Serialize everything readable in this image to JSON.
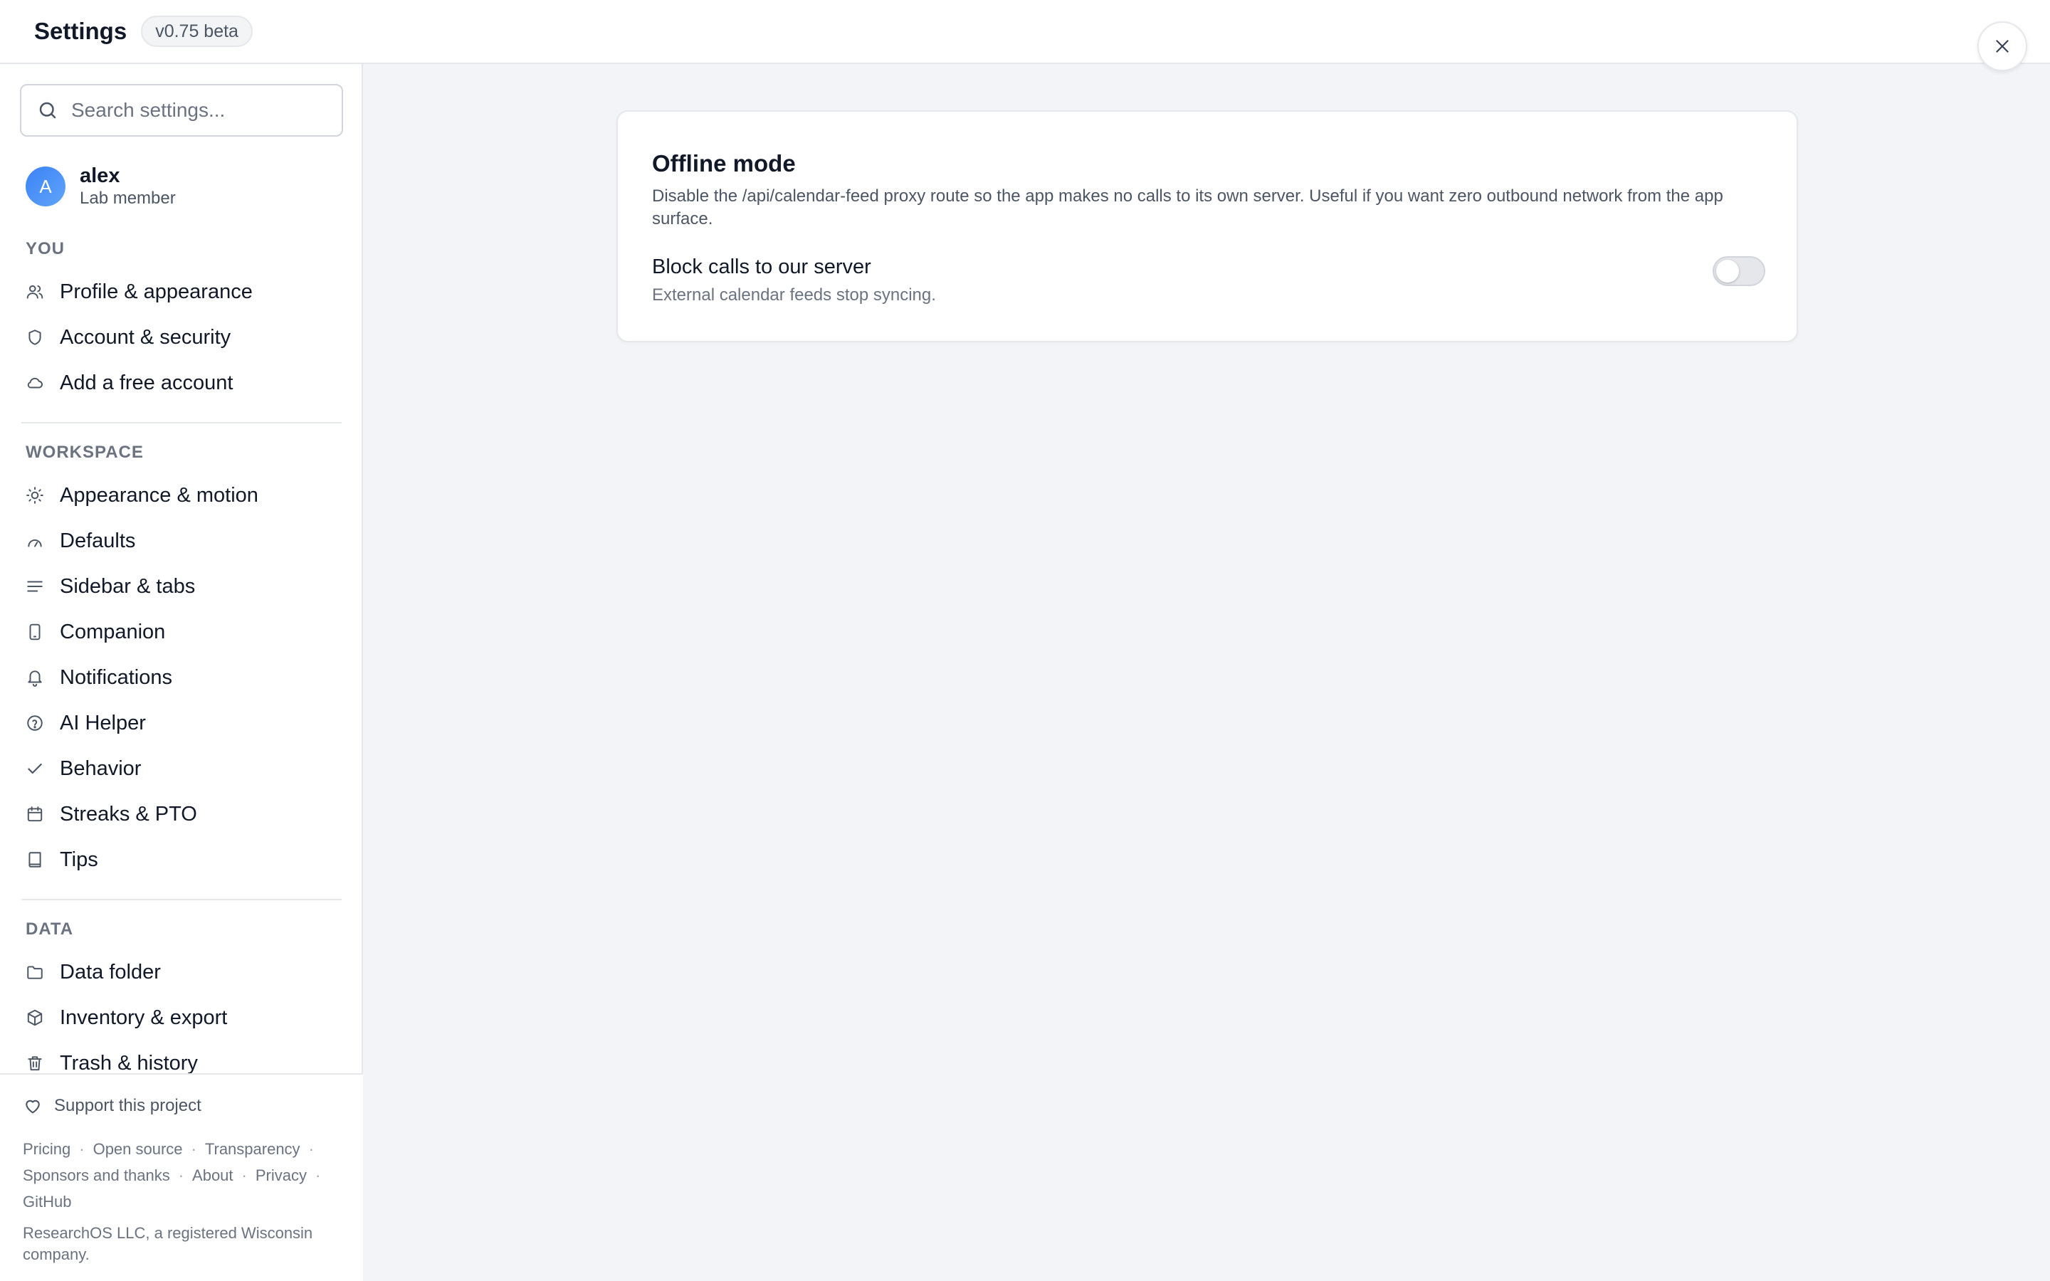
{
  "header": {
    "title": "Settings",
    "version": "v0.75 beta"
  },
  "search": {
    "placeholder": "Search settings..."
  },
  "user": {
    "initial": "A",
    "name": "alex",
    "role": "Lab member"
  },
  "sections": {
    "you": "YOU",
    "workspace": "WORKSPACE",
    "data": "DATA"
  },
  "nav": {
    "profile": "Profile & appearance",
    "account": "Account & security",
    "add_account": "Add a free account",
    "appearance": "Appearance & motion",
    "defaults": "Defaults",
    "sidebar_tabs": "Sidebar & tabs",
    "companion": "Companion",
    "notifications": "Notifications",
    "ai_helper": "AI Helper",
    "behavior": "Behavior",
    "streaks": "Streaks & PTO",
    "tips": "Tips",
    "data_folder": "Data folder",
    "inventory": "Inventory & export",
    "trash": "Trash & history"
  },
  "footer": {
    "support": "Support this project",
    "links": {
      "pricing": "Pricing",
      "open_source": "Open source",
      "transparency": "Transparency",
      "sponsors": "Sponsors and thanks",
      "about": "About",
      "privacy": "Privacy",
      "github": "GitHub"
    },
    "separator": "·",
    "company": "ResearchOS LLC, a registered Wisconsin company."
  },
  "card": {
    "title": "Offline mode",
    "description": "Disable the /api/calendar-feed proxy route so the app makes no calls to its own server. Useful if you want zero outbound network from the app surface.",
    "setting_title": "Block calls to our server",
    "setting_description": "External calendar feeds stop syncing.",
    "toggle_enabled": false
  }
}
